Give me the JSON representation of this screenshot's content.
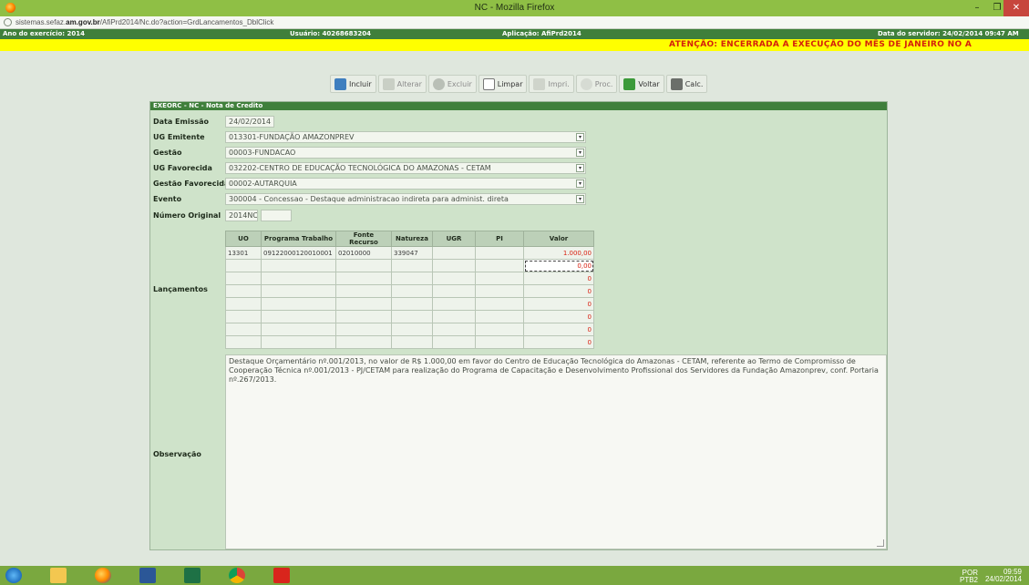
{
  "window": {
    "title": "NC - Mozilla Firefox",
    "min_glyph": "–",
    "max_glyph": "❐",
    "close_glyph": "✕",
    "url_prefix": "sistemas.sefaz.",
    "url_domain": "am.gov.br",
    "url_path": "/AfiPrd2014/Nc.do?action=GrdLancamentos_DblClick"
  },
  "infobar": {
    "year": "Ano do exercício: 2014",
    "user": "Usuário: 40268683204",
    "app": "Aplicação: AfiPrd2014",
    "server_date": "Data do servidor: 24/02/2014 09:47 AM"
  },
  "warning": "ATENÇÃO: ENCERRADA A EXECUÇÃO DO MÊS DE JANEIRO NO A",
  "toolbar": {
    "incluir": "Incluir",
    "alterar": "Alterar",
    "excluir": "Excluir",
    "limpar": "Limpar",
    "imprimir": "Impri.",
    "proc": "Proc.",
    "voltar": "Voltar",
    "calc": "Calc."
  },
  "panel": {
    "header": "EXEORC - NC - Nota de Credito",
    "fields": {
      "data_emissao": {
        "label": "Data Emissão",
        "value": "24/02/2014"
      },
      "ug_emitente": {
        "label": "UG Emitente",
        "value": "013301-FUNDAÇÃO AMAZONPREV"
      },
      "gestao": {
        "label": "Gestão",
        "value": "00003-FUNDACAO"
      },
      "ug_favorecida": {
        "label": "UG Favorecida",
        "value": "032202-CENTRO DE EDUCAÇÃO TECNOLÓGICA DO AMAZONAS - CETAM"
      },
      "gestao_favorecida": {
        "label": "Gestão Favorecida",
        "value": "00002-AUTARQUIA"
      },
      "evento": {
        "label": "Evento",
        "value": "300004 - Concessao - Destaque administracao indireta para administ. direta"
      },
      "numero_original": {
        "label": "Número Original",
        "value": "2014NC",
        "value2": ""
      }
    },
    "lancamentos_label": "Lançamentos",
    "observacao_label": "Observação",
    "dropdown_glyph": "▾"
  },
  "grid": {
    "headers": [
      "UO",
      "Programa Trabalho",
      "Fonte Recurso",
      "Natureza",
      "UGR",
      "PI",
      "Valor"
    ],
    "rows": [
      [
        "13301",
        "09122000120010001",
        "02010000",
        "339047",
        "",
        "",
        "1.000,00"
      ],
      [
        "",
        "",
        "",
        "",
        "",
        "",
        "0,00"
      ],
      [
        "",
        "",
        "",
        "",
        "",
        "",
        "0"
      ],
      [
        "",
        "",
        "",
        "",
        "",
        "",
        "0"
      ],
      [
        "",
        "",
        "",
        "",
        "",
        "",
        "0"
      ],
      [
        "",
        "",
        "",
        "",
        "",
        "",
        "0"
      ],
      [
        "",
        "",
        "",
        "",
        "",
        "",
        "0"
      ],
      [
        "",
        "",
        "",
        "",
        "",
        "",
        "0"
      ]
    ]
  },
  "observacao": "Destaque Orçamentário nº.001/2013, no valor de R$ 1.000,00 em favor do Centro de Educação Tecnológica do Amazonas - CETAM, referente ao Termo de Compromisso de Cooperação Técnica nº.001/2013 - PJ/CETAM para realização do Programa de Capacitação e Desenvolvimento Profissional dos Servidores da Fundação Amazonprev, conf. Portaria nº.267/2013.",
  "taskbar": {
    "apps": [
      "ie-icon",
      "explorer-icon",
      "firefox-icon",
      "word-icon",
      "excel-icon",
      "chrome-icon",
      "acrobat-icon"
    ],
    "lang": "POR",
    "lang2": "PTB2",
    "time": "09:59",
    "date": "24/02/2014"
  },
  "colors": {
    "header_green": "#3f7f3b",
    "warning_bg": "#ffff00",
    "warning_text": "#d4200c",
    "value_red": "#d91f10"
  }
}
